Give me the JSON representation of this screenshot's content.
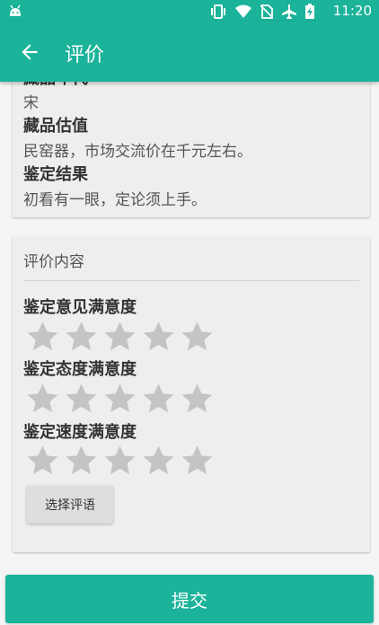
{
  "status_bar": {
    "time": "11:20",
    "icons": [
      "android-icon",
      "vibrate-icon",
      "wifi-icon",
      "no-sim-icon",
      "airplane-icon",
      "battery-icon"
    ]
  },
  "app_bar": {
    "title": "评价",
    "back_icon": "arrow-left-icon"
  },
  "info_card": {
    "partial_label": "藏品年代",
    "era_value": "宋",
    "estimate_label": "藏品估值",
    "estimate_value": "民窑器，市场交流价在千元左右。",
    "result_label": "鉴定结果",
    "result_value": "初看有一眼，定论须上手。"
  },
  "rating_card": {
    "title": "评价内容",
    "opinion_label": "鉴定意见满意度",
    "opinion_rating": 0,
    "attitude_label": "鉴定态度满意度",
    "attitude_rating": 0,
    "speed_label": "鉴定速度满意度",
    "speed_rating": 0,
    "max_stars": 5,
    "select_comment_label": "选择评语"
  },
  "submit_label": "提交",
  "colors": {
    "primary": "#1bb39a",
    "card": "#eeeeee",
    "star_empty": "#c4c4c4"
  }
}
